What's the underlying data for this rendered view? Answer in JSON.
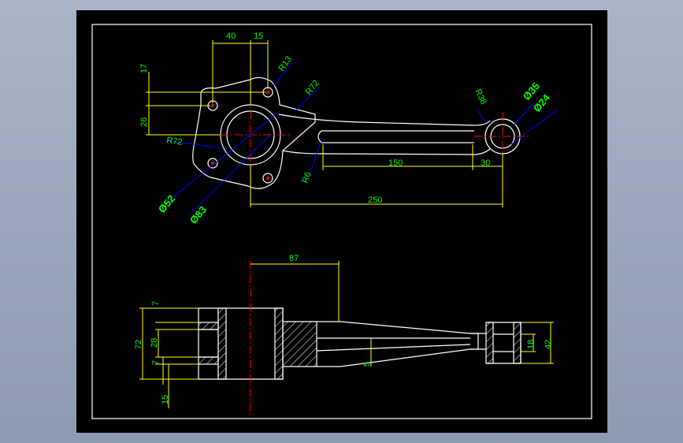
{
  "top_view": {
    "dims": {
      "d40": "40",
      "d15": "15",
      "d17": "17",
      "d26": "26",
      "r13": "R13",
      "r72a": "R72",
      "r72b": "R72",
      "d52": "Ø52",
      "d83": "Ø83",
      "r6": "R6",
      "d150": "150",
      "d30": "30",
      "d250": "250",
      "r38": "R38",
      "d35": "Ø35",
      "d24": "Ø24"
    }
  },
  "bottom_view": {
    "dims": {
      "d87": "87",
      "d7a": "7",
      "d72": "72",
      "d28": "28",
      "d7b": "7",
      "d15": "15",
      "d5": "5",
      "d18": "18",
      "d42": "42"
    }
  },
  "colors": {
    "background": "#000000",
    "frame": "#ffffff",
    "geometry": "#ffffff",
    "dimension_lines": "#ffff00",
    "dimension_text": "#00ff00",
    "center_lines": "#ff0000",
    "leaders": "#0000ff"
  }
}
